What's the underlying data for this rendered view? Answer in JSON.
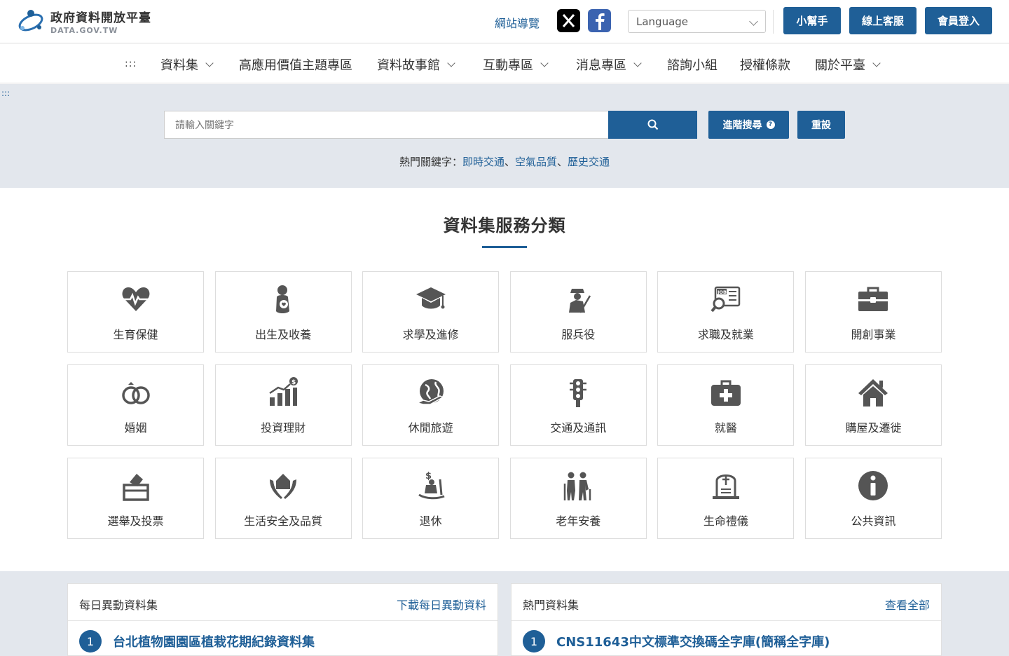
{
  "header": {
    "logo_title": "政府資料開放平臺",
    "logo_sub": "DATA.GOV.TW",
    "nav_guide": "網站導覽",
    "language_label": "Language",
    "buttons": [
      "小幫手",
      "線上客服",
      "會員登入"
    ]
  },
  "menu": {
    "dots": ":::",
    "items": [
      {
        "label": "資料集",
        "dropdown": true
      },
      {
        "label": "高應用價值主題專區",
        "dropdown": false
      },
      {
        "label": "資料故事館",
        "dropdown": true
      },
      {
        "label": "互動專區",
        "dropdown": true
      },
      {
        "label": "消息專區",
        "dropdown": true
      },
      {
        "label": "諮詢小組",
        "dropdown": false
      },
      {
        "label": "授權條款",
        "dropdown": false
      },
      {
        "label": "關於平臺",
        "dropdown": true
      }
    ]
  },
  "search": {
    "corner_dots": ":::",
    "placeholder": "請輸入關鍵字",
    "advanced_label": "進階搜尋",
    "reset_label": "重設",
    "hot_label": "熱門關鍵字：",
    "hot_keywords": [
      "即時交通",
      "空氣品質",
      "歷史交通"
    ],
    "separator": "、"
  },
  "categories": {
    "title": "資料集服務分類",
    "items": [
      {
        "label": "生育保健",
        "icon": "heartbeat-icon"
      },
      {
        "label": "出生及收養",
        "icon": "baby-icon"
      },
      {
        "label": "求學及進修",
        "icon": "graduation-cap-icon"
      },
      {
        "label": "服兵役",
        "icon": "soldier-icon"
      },
      {
        "label": "求職及就業",
        "icon": "job-search-icon"
      },
      {
        "label": "開創事業",
        "icon": "briefcase-icon"
      },
      {
        "label": "婚姻",
        "icon": "rings-icon"
      },
      {
        "label": "投資理財",
        "icon": "investment-chart-icon"
      },
      {
        "label": "休閒旅遊",
        "icon": "globe-plane-icon"
      },
      {
        "label": "交通及通訊",
        "icon": "traffic-light-icon"
      },
      {
        "label": "就醫",
        "icon": "medical-kit-icon"
      },
      {
        "label": "購屋及遷徙",
        "icon": "house-icon"
      },
      {
        "label": "選舉及投票",
        "icon": "ballot-box-icon"
      },
      {
        "label": "生活安全及品質",
        "icon": "home-protection-icon"
      },
      {
        "label": "退休",
        "icon": "rocking-chair-icon"
      },
      {
        "label": "老年安養",
        "icon": "elderly-icon"
      },
      {
        "label": "生命禮儀",
        "icon": "tombstone-icon"
      },
      {
        "label": "公共資訊",
        "icon": "info-icon"
      }
    ]
  },
  "panels": {
    "daily": {
      "title": "每日異動資料集",
      "link": "下載每日異動資料",
      "first_number": "1",
      "first_item": "台北植物園園區植栽花期紀錄資料集"
    },
    "popular": {
      "title": "熱門資料集",
      "link": "查看全部",
      "first_number": "1",
      "first_item": "CNS11643中文標準交換碼全字庫(簡稱全字庫)"
    }
  },
  "colors": {
    "primary": "#1f5f97",
    "band": "#e3e7ed",
    "icon_gray": "#555555"
  }
}
